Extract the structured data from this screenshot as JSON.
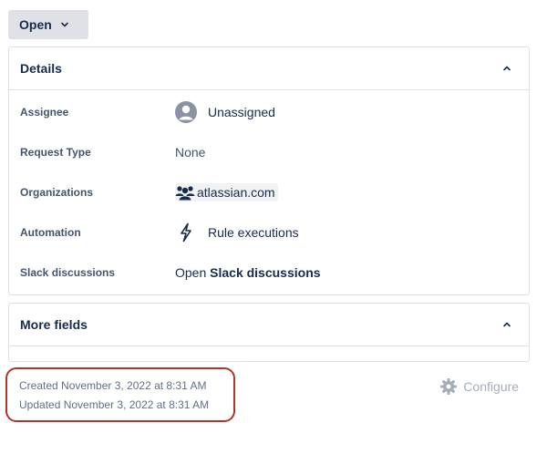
{
  "status": {
    "label": "Open",
    "chevron_icon": "chevron-down-icon"
  },
  "details": {
    "title": "Details",
    "collapse_icon": "chevron-up-icon",
    "fields": {
      "assignee": {
        "label": "Assignee",
        "value": "Unassigned",
        "icon": "avatar-icon"
      },
      "request_type": {
        "label": "Request Type",
        "value": "None"
      },
      "organizations": {
        "label": "Organizations",
        "value": "atlassian.com",
        "icon": "people-group-icon"
      },
      "automation": {
        "label": "Automation",
        "value": "Rule executions",
        "icon": "lightning-bolt-icon"
      },
      "slack": {
        "label": "Slack discussions",
        "prefix": "Open",
        "link": "Slack discussions"
      }
    }
  },
  "more_fields": {
    "title": "More fields",
    "collapse_icon": "chevron-up-icon"
  },
  "footer": {
    "created": "Created November 3, 2022 at 8:31 AM",
    "updated": "Updated November 3, 2022 at 8:31 AM",
    "configure_label": "Configure",
    "configure_icon": "gear-icon",
    "highlight_color": "#b0352a"
  }
}
